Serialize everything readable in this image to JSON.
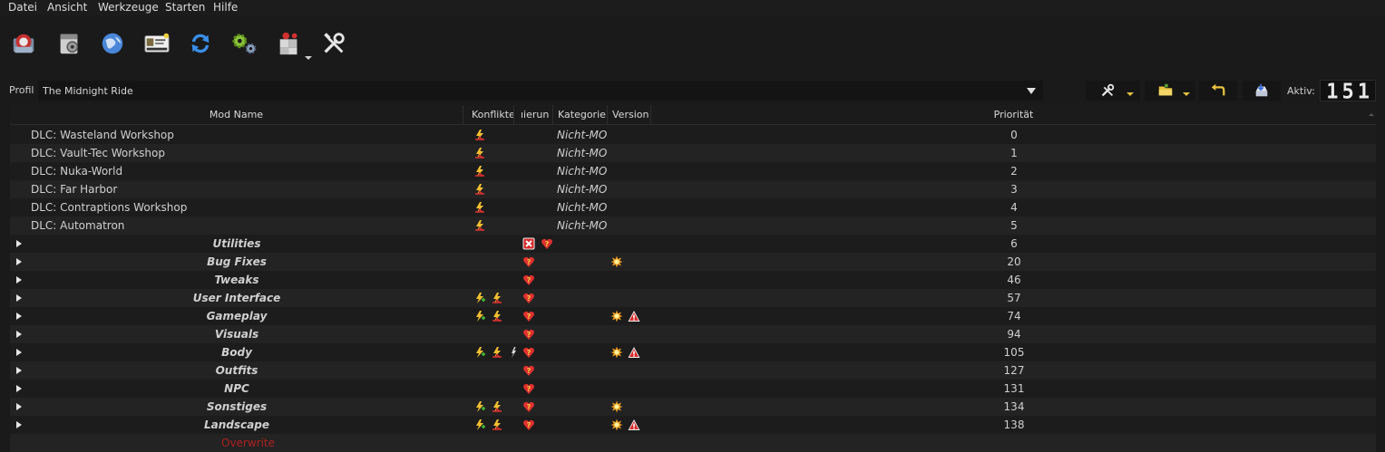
{
  "menu": [
    "Datei",
    "Ansicht",
    "Werkzeuge",
    "Starten",
    "Hilfe"
  ],
  "toolbar": {
    "icons": [
      "install-mod-icon",
      "nexus-icon",
      "browser-icon",
      "profiles-icon",
      "refresh-icon",
      "settings-icon",
      "tools-icon",
      "wrench-icon"
    ]
  },
  "profile": {
    "label": "Profil",
    "value": "The Midnight Ride"
  },
  "aktiv": {
    "label": "Aktiv:",
    "value": "151"
  },
  "columns": {
    "name": "Mod Name",
    "conflicts": "Konflikte",
    "flags": "ıierun",
    "category": "Kategorie",
    "version": "Version",
    "priority": "Priorität"
  },
  "rows": [
    {
      "name": "DLC: Wasteland Workshop",
      "sep": false,
      "conflicts": [
        "overwritten"
      ],
      "flags": [],
      "category": "Nicht-MO",
      "version": [],
      "priority": "0"
    },
    {
      "name": "DLC: Vault-Tec Workshop",
      "sep": false,
      "conflicts": [
        "overwritten"
      ],
      "flags": [],
      "category": "Nicht-MO",
      "version": [],
      "priority": "1"
    },
    {
      "name": "DLC: Nuka-World",
      "sep": false,
      "conflicts": [
        "overwritten"
      ],
      "flags": [],
      "category": "Nicht-MO",
      "version": [],
      "priority": "2"
    },
    {
      "name": "DLC: Far Harbor",
      "sep": false,
      "conflicts": [
        "overwritten"
      ],
      "flags": [],
      "category": "Nicht-MO",
      "version": [],
      "priority": "3"
    },
    {
      "name": "DLC: Contraptions Workshop",
      "sep": false,
      "conflicts": [
        "overwritten"
      ],
      "flags": [],
      "category": "Nicht-MO",
      "version": [],
      "priority": "4"
    },
    {
      "name": "DLC: Automatron",
      "sep": false,
      "conflicts": [
        "overwritten"
      ],
      "flags": [],
      "category": "Nicht-MO",
      "version": [],
      "priority": "5"
    },
    {
      "name": "Utilities",
      "sep": true,
      "conflicts": [],
      "flags": [
        "error",
        "notes"
      ],
      "category": "",
      "version": [],
      "priority": "6"
    },
    {
      "name": "Bug Fixes",
      "sep": true,
      "conflicts": [],
      "flags": [
        "notes"
      ],
      "category": "",
      "version": [
        "update"
      ],
      "priority": "20"
    },
    {
      "name": "Tweaks",
      "sep": true,
      "conflicts": [],
      "flags": [
        "notes"
      ],
      "category": "",
      "version": [],
      "priority": "46"
    },
    {
      "name": "User Interface",
      "sep": true,
      "conflicts": [
        "overwrites",
        "overwritten"
      ],
      "flags": [
        "notes"
      ],
      "category": "",
      "version": [],
      "priority": "57"
    },
    {
      "name": "Gameplay",
      "sep": true,
      "conflicts": [
        "overwrites",
        "overwritten"
      ],
      "flags": [
        "notes"
      ],
      "category": "",
      "version": [
        "update",
        "warning"
      ],
      "priority": "74"
    },
    {
      "name": "Visuals",
      "sep": true,
      "conflicts": [],
      "flags": [
        "notes"
      ],
      "category": "",
      "version": [],
      "priority": "94"
    },
    {
      "name": "Body",
      "sep": true,
      "conflicts": [
        "overwrites",
        "overwritten",
        "redundant"
      ],
      "flags": [
        "notes"
      ],
      "category": "",
      "version": [
        "update",
        "warning"
      ],
      "priority": "105"
    },
    {
      "name": "Outfits",
      "sep": true,
      "conflicts": [],
      "flags": [
        "notes"
      ],
      "category": "",
      "version": [],
      "priority": "127"
    },
    {
      "name": "NPC",
      "sep": true,
      "conflicts": [],
      "flags": [
        "notes"
      ],
      "category": "",
      "version": [],
      "priority": "131"
    },
    {
      "name": "Sonstiges",
      "sep": true,
      "conflicts": [
        "overwrites",
        "overwritten"
      ],
      "flags": [
        "notes"
      ],
      "category": "",
      "version": [
        "update"
      ],
      "priority": "134"
    },
    {
      "name": "Landscape",
      "sep": true,
      "conflicts": [
        "overwrites",
        "overwritten"
      ],
      "flags": [
        "notes"
      ],
      "category": "",
      "version": [
        "update",
        "warning"
      ],
      "priority": "138"
    }
  ],
  "overwrite": "Overwrite"
}
